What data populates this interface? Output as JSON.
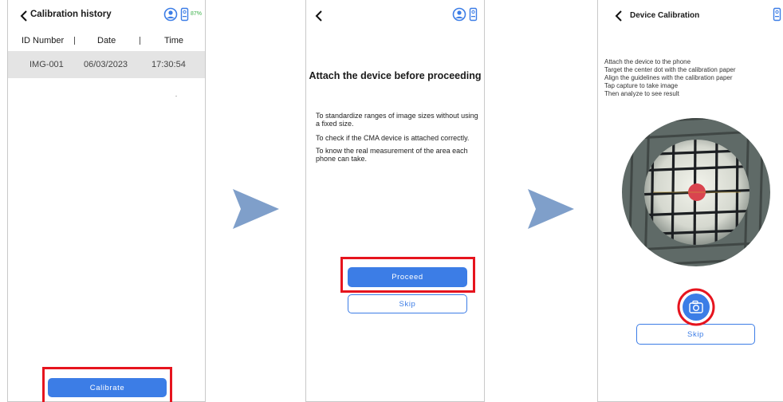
{
  "screen1": {
    "title": "Calibration history",
    "battery": "87%",
    "columns": {
      "id": "ID Number",
      "date": "Date",
      "time": "Time"
    },
    "rows": [
      {
        "id": "IMG-001",
        "date": "06/03/2023",
        "time": "17:30:54"
      }
    ],
    "calibrate_label": "Calibrate"
  },
  "screen2": {
    "heading": "Attach the device before proceeding",
    "paragraphs": [
      "To standardize ranges of image sizes without using a fixed size.",
      "To check if the CMA device is attached correctly.",
      "To know the real measurement of the area each phone can take."
    ],
    "proceed_label": "Proceed",
    "skip_label": "Skip"
  },
  "screen3": {
    "title": "Device Calibration",
    "instructions": [
      "Attach the device to the phone",
      "Target the center dot with the calibration paper",
      "Align the guidelines with the calibration paper",
      "Tap capture to take image",
      "Then analyze to see result"
    ],
    "skip_label": "Skip"
  },
  "colors": {
    "accent": "#3c7de6",
    "highlight": "#e6141e",
    "arrow": "#7f9fca"
  }
}
